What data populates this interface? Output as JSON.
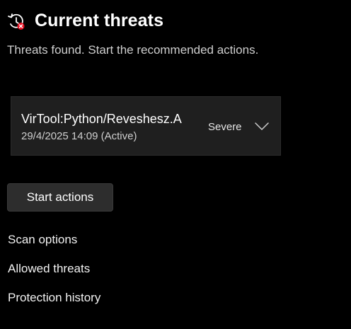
{
  "header": {
    "icon": "history-clock-warning-icon",
    "title": "Current threats",
    "subtitle": "Threats found. Start the recommended actions."
  },
  "threat": {
    "name": "VirTool:Python/Reveshesz.A",
    "date_status": "29/4/2025 14:09 (Active)",
    "severity": "Severe",
    "expand_icon": "chevron-down-icon"
  },
  "actions": {
    "start_label": "Start actions"
  },
  "links": [
    "Scan options",
    "Allowed threats",
    "Protection history"
  ],
  "colors": {
    "background": "#000000",
    "card": "#1f1f1f",
    "button": "#2d2d2d",
    "alert_badge": "#e81123"
  }
}
